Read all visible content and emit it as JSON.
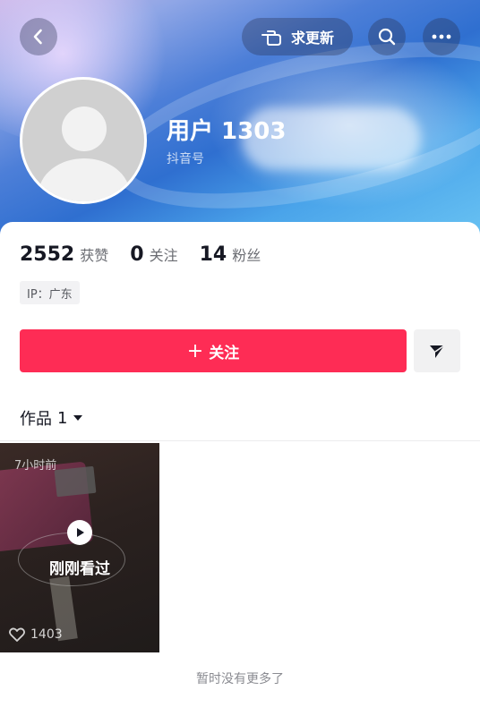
{
  "header": {
    "update_button_label": "求更新",
    "username": "用户 1303",
    "douyin_id_label": "抖音号"
  },
  "stats": {
    "likes_count": "2552",
    "likes_label": "获赞",
    "following_count": "0",
    "following_label": "关注",
    "followers_count": "14",
    "followers_label": "粉丝"
  },
  "ip_tag": "IP：广东",
  "actions": {
    "follow_label": "关注",
    "follow_prefix": "+"
  },
  "works_tab": {
    "label": "作品",
    "count": "1"
  },
  "videos": [
    {
      "time": "7小时前",
      "watched_label": "刚刚看过",
      "likes": "1403"
    }
  ],
  "footer_text": "暂时没有更多了",
  "colors": {
    "accent": "#fe2c55",
    "text_primary": "#161823",
    "text_secondary": "#6b6d73"
  }
}
